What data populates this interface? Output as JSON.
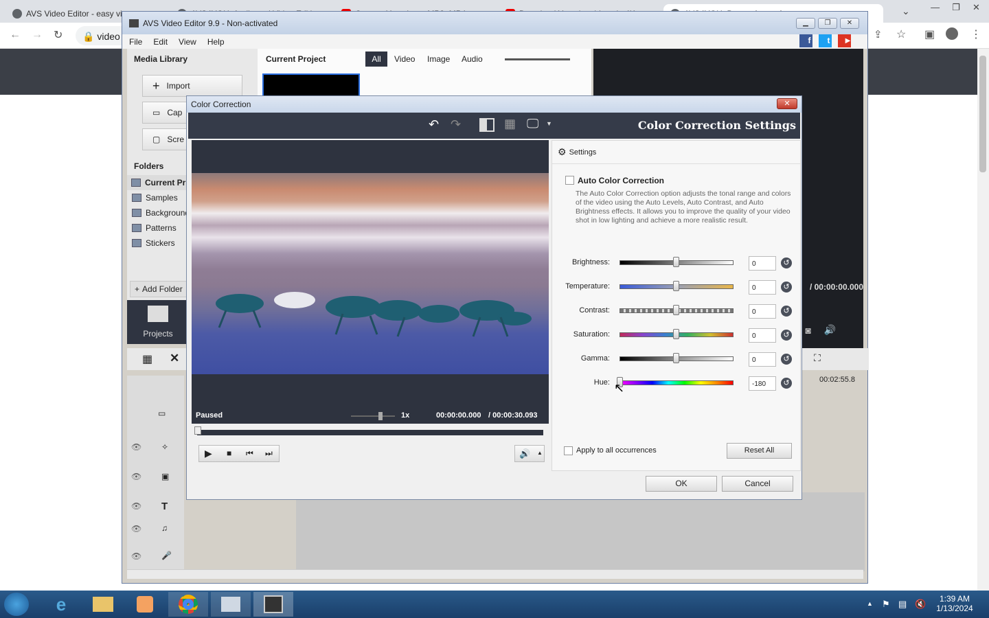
{
  "browser": {
    "tabs": [
      {
        "label": "AVS Video Editor - easy vi",
        "icon": "globe-icon"
      },
      {
        "label": "AVS4YOU: Audio and Video Editi",
        "icon": "globe-icon"
      },
      {
        "label": "Convert Youtube to MP3, MP4",
        "icon": "youtube-icon"
      },
      {
        "label": "Download Youtube videos in 4K",
        "icon": "youtube-icon"
      },
      {
        "label": "AVS4YOU: Best software for",
        "icon": "globe-icon"
      }
    ],
    "address": "video"
  },
  "avs": {
    "title": "AVS Video Editor 9.9 - Non-activated",
    "menu": [
      "File",
      "Edit",
      "View",
      "Help"
    ],
    "media_library": "Media Library",
    "import": "Import",
    "capture": "Cap",
    "screen": "Scre",
    "folders_label": "Folders",
    "folders": [
      "Current Pr",
      "Samples",
      "Backgrounds",
      "Patterns",
      "Stickers"
    ],
    "add_folder": "Add Folder",
    "projects": "Projects",
    "current_project": "Current Project",
    "filter_tabs": [
      "All",
      "Video",
      "Image",
      "Audio"
    ],
    "time_right": "/ 00:00:00.000",
    "time_ruler": "00:02:55.8"
  },
  "dialog": {
    "title": "Color Correction",
    "header": "Color Correction Settings",
    "status": "Paused",
    "speed": "1x",
    "time_current": "00:00:00.000",
    "time_total": "/ 00:00:30.093",
    "settings_label": "Settings",
    "auto_label": "Auto Color Correction",
    "auto_desc": "The Auto Color Correction option adjusts the tonal range and colors of the video using the Auto Levels, Auto Contrast, and Auto Brightness effects. It allows you to improve the quality of your video shot in low lighting and achieve a more realistic result.",
    "sliders": [
      {
        "label": "Brightness:",
        "value": "0",
        "level": 0.5
      },
      {
        "label": "Temperature:",
        "value": "0",
        "level": 0.5
      },
      {
        "label": "Contrast:",
        "value": "0",
        "level": 0.5
      },
      {
        "label": "Saturation:",
        "value": "0",
        "level": 0.5
      },
      {
        "label": "Gamma:",
        "value": "0",
        "level": 0.5
      },
      {
        "label": "Hue:",
        "value": "-180",
        "level": 0.0
      }
    ],
    "apply_all": "Apply to all occurrences",
    "reset_all": "Reset All",
    "ok": "OK",
    "cancel": "Cancel"
  },
  "taskbar": {
    "time": "1:39 AM",
    "date": "1/13/2024"
  }
}
